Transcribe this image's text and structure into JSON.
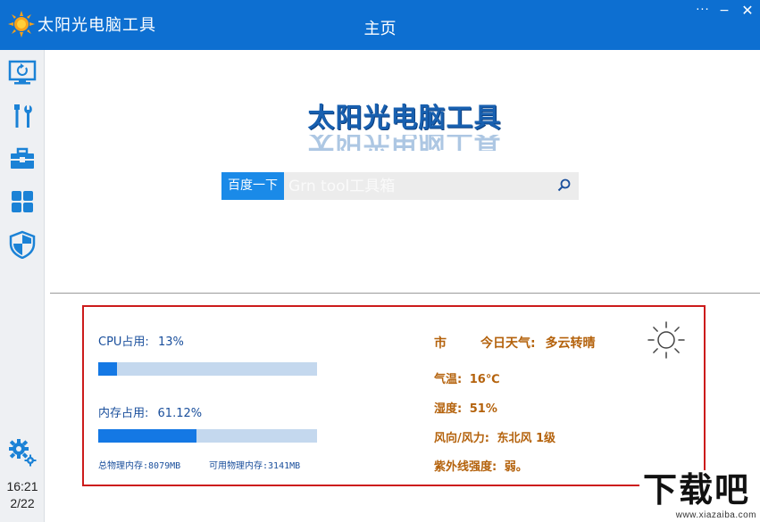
{
  "titlebar": {
    "app_name": "太阳光电脑工具",
    "page_title": "主页",
    "more_label": "···",
    "minimize_label": "−",
    "close_label": "✕",
    "color": "#0d6fd1"
  },
  "sidebar": {
    "items": [
      {
        "name": "monitor-refresh-icon"
      },
      {
        "name": "tools-icon"
      },
      {
        "name": "toolbox-icon"
      },
      {
        "name": "apps-grid-icon"
      },
      {
        "name": "shield-icon"
      }
    ],
    "settings_icon": "gears-icon",
    "clock_time": "16:21",
    "clock_date": "2/22"
  },
  "brand": {
    "text": "太阳光电脑工具"
  },
  "search": {
    "button_label": "百度一下",
    "placeholder": "Grn tool工具箱",
    "icon": "search-icon"
  },
  "system": {
    "cpu_label": "CPU占用:",
    "cpu_value": "13%",
    "cpu_fraction": 0.085,
    "mem_label": "内存占用:",
    "mem_value": "61.12%",
    "mem_fraction": 0.45,
    "total_mem_label": "总物理内存:",
    "total_mem_value": "8079MB",
    "avail_mem_label": "可用物理内存:",
    "avail_mem_value": "3141MB"
  },
  "weather": {
    "city": "市",
    "today_label": "今日天气:",
    "today_value": "多云转晴",
    "temp_label": "气温:",
    "temp_value": "16℃",
    "humidity_label": "湿度:",
    "humidity_value": "51%",
    "wind_label": "风向/风力:",
    "wind_value": "东北风 1级",
    "uv_label": "紫外线强度:",
    "uv_value": "弱。",
    "icon": "sun-icon"
  },
  "watermark": {
    "big": "下载吧",
    "small": "www.xiazaiba.com"
  },
  "colors": {
    "accent": "#0d6fd1",
    "panel_border": "#cc1b1b",
    "weather_text": "#b4620c",
    "bar_fill": "#1478e4",
    "bar_track": "#c4d8ee"
  }
}
